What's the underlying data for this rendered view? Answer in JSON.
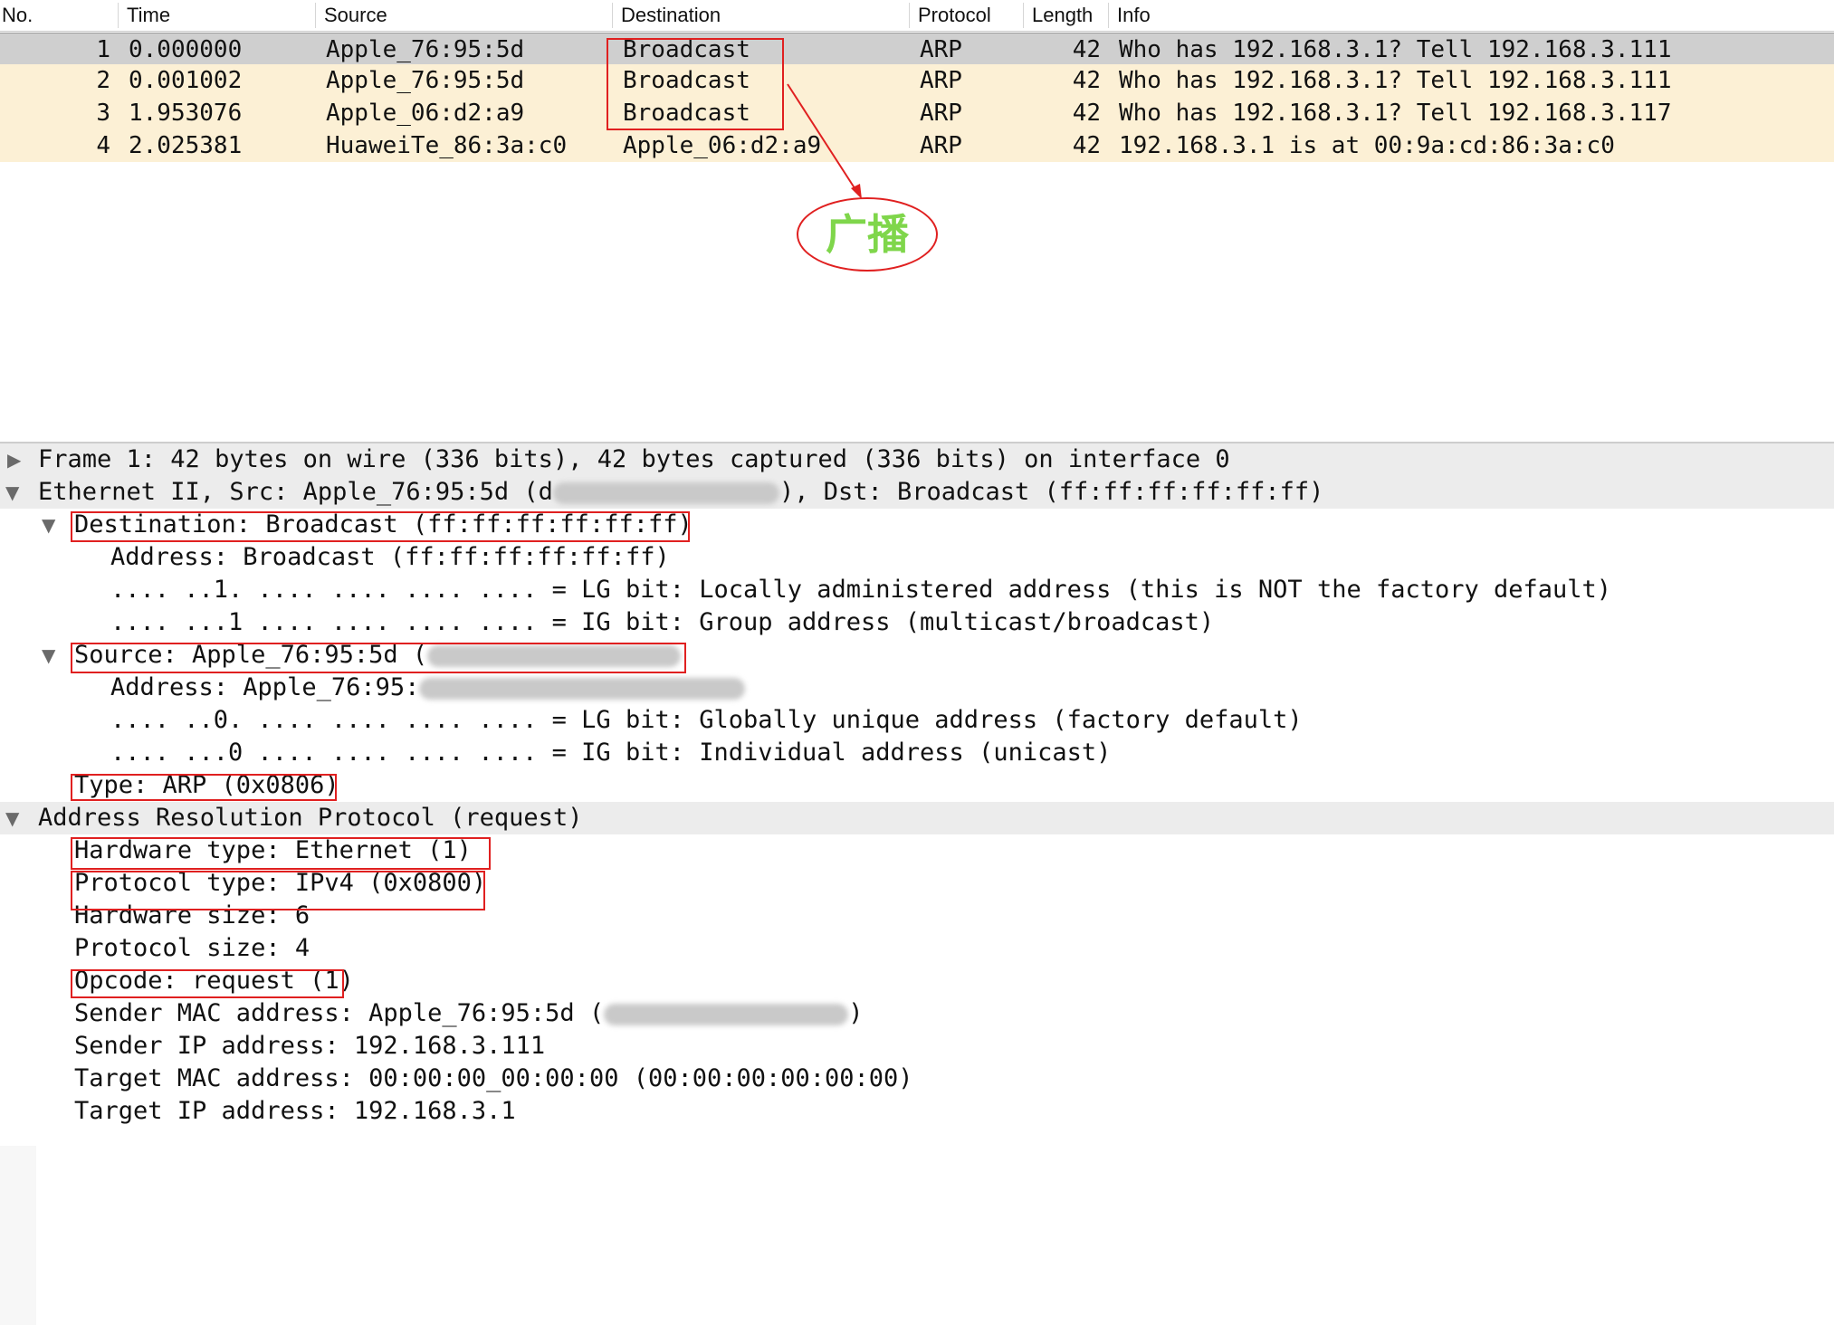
{
  "packet_list": {
    "columns": [
      "No.",
      "Time",
      "Source",
      "Destination",
      "Protocol",
      "Length",
      "Info"
    ],
    "rows": [
      {
        "no": "1",
        "time": "0.000000",
        "source": "Apple_76:95:5d",
        "destination": "Broadcast",
        "protocol": "ARP",
        "length": "42",
        "info": "Who has 192.168.3.1? Tell 192.168.3.111",
        "selected": true
      },
      {
        "no": "2",
        "time": "0.001002",
        "source": "Apple_76:95:5d",
        "destination": "Broadcast",
        "protocol": "ARP",
        "length": "42",
        "info": "Who has 192.168.3.1? Tell 192.168.3.111",
        "selected": false
      },
      {
        "no": "3",
        "time": "1.953076",
        "source": "Apple_06:d2:a9",
        "destination": "Broadcast",
        "protocol": "ARP",
        "length": "42",
        "info": "Who has 192.168.3.1? Tell 192.168.3.117",
        "selected": false
      },
      {
        "no": "4",
        "time": "2.025381",
        "source": "HuaweiTe_86:3a:c0",
        "destination": "Apple_06:d2:a9",
        "protocol": "ARP",
        "length": "42",
        "info": "192.168.3.1 is at 00:9a:cd:86:3a:c0",
        "selected": false
      }
    ]
  },
  "annotation": {
    "label": "广播",
    "color": "#e02020",
    "label_color": "#7fd64b"
  },
  "details": {
    "frame": "Frame 1: 42 bytes on wire (336 bits), 42 bytes captured (336 bits) on interface 0",
    "ethernet_prefix": "Ethernet II, Src: Apple_76:95:5d (d",
    "ethernet_suffix": "), Dst: Broadcast (ff:ff:ff:ff:ff:ff)",
    "dst_header": "Destination: Broadcast (ff:ff:ff:ff:ff:ff)",
    "dst_address": "Address: Broadcast (ff:ff:ff:ff:ff:ff)",
    "dst_lg": ".... ..1. .... .... .... .... = LG bit: Locally administered address (this is NOT the factory default)",
    "dst_ig": ".... ...1 .... .... .... .... = IG bit: Group address (multicast/broadcast)",
    "src_header_prefix": "Source: Apple_76:95:5d (",
    "src_address_prefix": "Address: Apple_76:95:",
    "src_lg": ".... ..0. .... .... .... .... = LG bit: Globally unique address (factory default)",
    "src_ig": ".... ...0 .... .... .... .... = IG bit: Individual address (unicast)",
    "type": "Type: ARP (0x0806)",
    "arp_header": "Address Resolution Protocol (request)",
    "hw_type": "Hardware type: Ethernet (1)",
    "proto_type": "Protocol type: IPv4 (0x0800)",
    "hw_size": "Hardware size: 6",
    "proto_size": "Protocol size: 4",
    "opcode": "Opcode: request (1)",
    "sender_mac_prefix": "Sender MAC address: Apple_76:95:5d (",
    "sender_mac_suffix": ")",
    "sender_ip": "Sender IP address: 192.168.3.111",
    "target_mac": "Target MAC address: 00:00:00_00:00:00 (00:00:00:00:00:00)",
    "target_ip": "Target IP address: 192.168.3.1"
  }
}
